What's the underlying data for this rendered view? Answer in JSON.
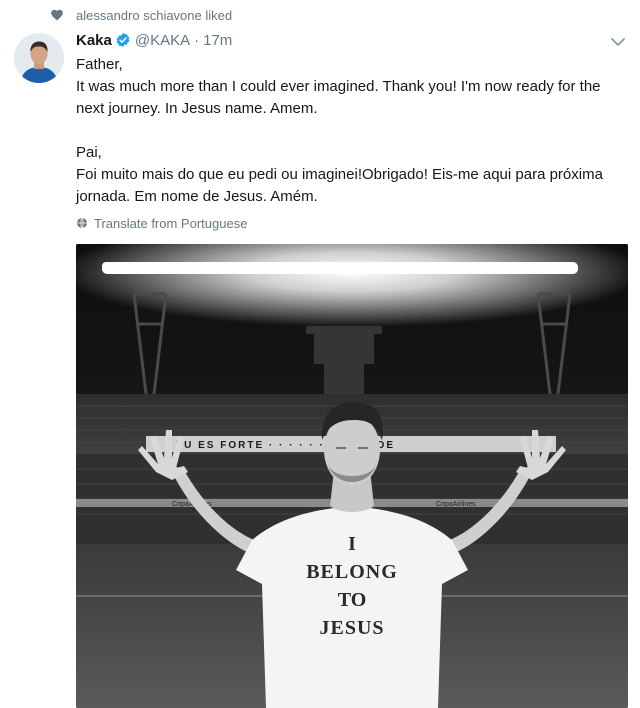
{
  "social_context": {
    "icon": "heart-icon",
    "text": "alessandro schiavone liked"
  },
  "tweet": {
    "author_name": "Kaka",
    "verified": true,
    "handle": "@KAKA",
    "separator": "·",
    "time": "17m",
    "menu_icon": "chevron-down-icon",
    "lines": [
      "Father,",
      "It was much more than I could ever imagined. Thank you! I'm now ready for the",
      "next journey. In Jesus name. Amem.",
      "",
      "Pai,",
      "Foi muito mais do que eu pedi ou imaginei!Obrigado! Eis-me aqui para próxima",
      "jornada. Em nome de Jesus. Amém."
    ],
    "translate_label": "Translate from Portuguese"
  },
  "media": {
    "shirt_text": [
      "I",
      "BELONG",
      "TO",
      "JESUS"
    ],
    "banner_text": "TU ES FORTE · · · · · · · GRANDE",
    "sponsor_left": "CopaAirlines",
    "sponsor_right": "CopaAirlines"
  },
  "colors": {
    "text_primary": "#14171a",
    "text_secondary": "#657786",
    "verified_blue": "#1da1f2"
  }
}
